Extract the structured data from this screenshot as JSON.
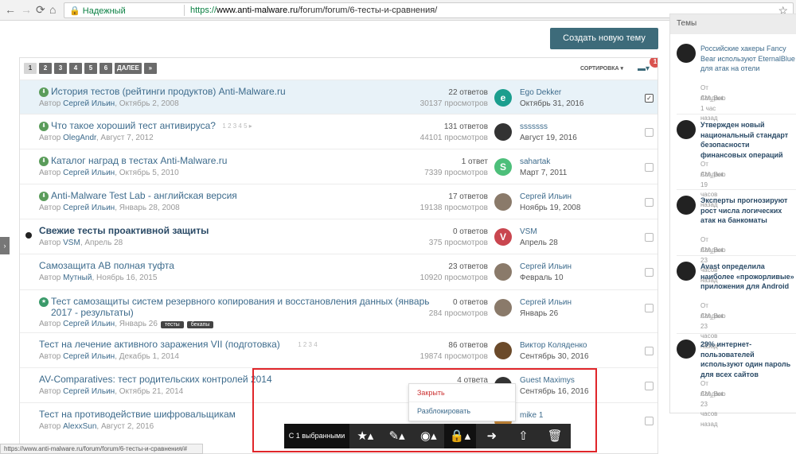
{
  "browser": {
    "back": "←",
    "forward": "→",
    "reload": "⟳",
    "home": "⌂",
    "secure_label": "Надежный",
    "url_scheme": "https://",
    "url_host": "www.anti-malware.ru",
    "url_path": "/forum/forum/6-тесты-и-сравнения/",
    "bookmark_icon": "☆"
  },
  "create_button": "Создать новую тему",
  "pagination": [
    "1",
    "2",
    "3",
    "4",
    "5",
    "6",
    "ДАЛЕЕ",
    "»"
  ],
  "sort_label": "СОРТИРОВКА ▾",
  "mod_badge": "1",
  "topics": [
    {
      "title": "История тестов (рейтинги продуктов) Anti-Malware.ru",
      "prefix": "Автор",
      "author": "Сергей Ильин",
      "date": "Октябрь 2, 2008",
      "replies": "22 ответов",
      "views": "30137 просмотров",
      "last_user": "Ego Dekker",
      "last_date": "Октябрь 31, 2016",
      "avatar": "e",
      "avatar_color": "#1b9e8e",
      "pinned": true,
      "checked": true
    },
    {
      "title": "Что такое хороший тест антивируса?",
      "prefix": "Автор",
      "author": "OlegAndr",
      "date": "Август 7, 2012",
      "replies": "131 ответов",
      "views": "44101 просмотров",
      "last_user": "sssssss",
      "last_date": "Август 19, 2016",
      "avatar": "",
      "avatar_color": "#333333",
      "pinned": true,
      "pages": "1  2  3  4  5 ▸"
    },
    {
      "title": "Каталог наград в тестах Anti-Malware.ru",
      "prefix": "Автор",
      "author": "Сергей Ильин",
      "date": "Октябрь 5, 2010",
      "replies": "1 ответ",
      "views": "7339 просмотров",
      "last_user": "sahartak",
      "last_date": "Март 7, 2011",
      "avatar": "S",
      "avatar_color": "#4dbf7a",
      "pinned": true
    },
    {
      "title": "Anti-Malware Test Lab - английская версия",
      "prefix": "Автор",
      "author": "Сергей Ильин",
      "date": "Январь 28, 2008",
      "replies": "17 ответов",
      "views": "19138 просмотров",
      "last_user": "Сергей Ильин",
      "last_date": "Ноябрь 19, 2008",
      "avatar": "",
      "avatar_color": "#8a7a6a",
      "pinned": true
    },
    {
      "title": "Свежие тесты проактивной защиты",
      "prefix": "Автор",
      "author": "VSM",
      "date": "Апрель 28",
      "replies": "0 ответов",
      "views": "375 просмотров",
      "last_user": "VSM",
      "last_date": "Апрель 28",
      "avatar": "V",
      "avatar_color": "#c9464f",
      "unread": true
    },
    {
      "title": "Самозащита АВ полная туфта",
      "prefix": "Автор",
      "author": "Мутный",
      "date": "Ноябрь 16, 2015",
      "replies": "23 ответов",
      "views": "10920 просмотров",
      "last_user": "Сергей Ильин",
      "last_date": "Февраль 10",
      "avatar": "",
      "avatar_color": "#8a7a6a"
    },
    {
      "title": "Тест самозащиты систем резервного копирования и восстановления данных (январь",
      "title2": "2017 - результаты)",
      "prefix": "Автор",
      "author": "Сергей Ильин",
      "date": "Январь 26",
      "tags": [
        "тесты",
        "бекапы"
      ],
      "replies": "0 ответов",
      "views": "284 просмотров",
      "last_user": "Сергей Ильин",
      "last_date": "Январь 26",
      "avatar": "",
      "avatar_color": "#8a7a6a",
      "featured": true
    },
    {
      "title": "Тест на лечение активного заражения VII (подготовка)",
      "prefix": "Автор",
      "author": "Сергей Ильин",
      "date": "Декабрь 1, 2014",
      "replies": "86 ответов",
      "views": "19874 просмотров",
      "last_user": "Виктор Коляденко",
      "last_date": "Сентябрь 30, 2016",
      "avatar": "",
      "avatar_color": "#6b4a2a",
      "pages": "1  2  3  4"
    },
    {
      "title": "AV-Comparatives: тест родительских контролей 2014",
      "prefix": "Автор",
      "author": "Сергей Ильин",
      "date": "Октябрь 21, 2014",
      "replies": "4 ответа",
      "views": "",
      "last_user": "Guest Maximys",
      "last_date": "Сентябрь 16, 2016",
      "avatar": "",
      "avatar_color": "#333333"
    },
    {
      "title": "Тест на противодействие шифровальщикам",
      "prefix": "Автор",
      "author": "AlexxSun",
      "date": "Август 2, 2016",
      "replies": "",
      "views": "",
      "last_user": "mike 1",
      "last_date": "",
      "avatar": "",
      "avatar_color": "#c98a3a"
    }
  ],
  "sidebar": {
    "title": "Темы",
    "items": [
      {
        "title": "Российские хакеры Fancy Bear используют EternalBlue для атак на отели",
        "by": "От AM_Bot",
        "time": "Создано 1 час назад",
        "bold": false
      },
      {
        "title": "Утвержден новый национальный стандарт безопасности финансовых операций",
        "by": "От AM_Bot",
        "time": "Создано 19 часов назад",
        "bold": true
      },
      {
        "title": "Эксперты прогнозируют рост числа логических атак на банкоматы",
        "by": "От AM_Bot",
        "time": "Создано 23 часов назад",
        "bold": true
      },
      {
        "title": "Avast определила наиболее «прожорливые» приложения для Android",
        "by": "От AM_Bot",
        "time": "Создано 23 часов назад",
        "bold": true
      },
      {
        "title": "29% интернет-пользователей используют один пароль для всех сайтов",
        "by": "От AM_Bot",
        "time": "Создано 23 часов назад",
        "bold": true
      }
    ]
  },
  "popup": {
    "close": "Закрыть",
    "unlock": "Разблокировать"
  },
  "modbar": {
    "selected": "С 1 выбранными",
    "icons": [
      "★▴",
      "✎▴",
      "◉▴",
      "🔒▴",
      "➜",
      "⇧",
      "🗑"
    ]
  },
  "status_url": "https://www.anti-malware.ru/forum/forum/6-тесты-и-сравнения/#"
}
